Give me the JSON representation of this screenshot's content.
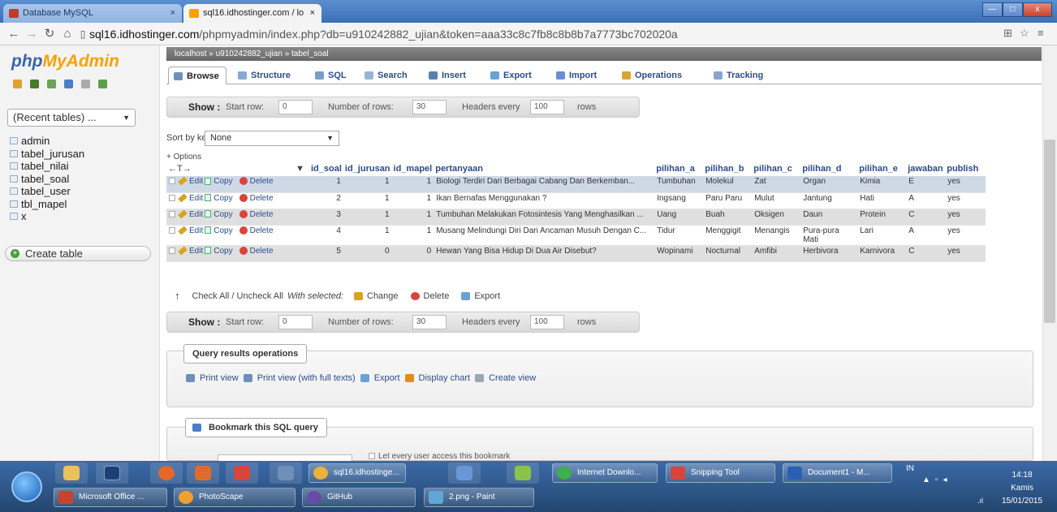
{
  "browser": {
    "tabs": [
      {
        "title": "Database MySQL",
        "close": "×"
      },
      {
        "title": "sql16.idhostinger.com / lo",
        "close": "×"
      }
    ],
    "url_host": "sql16.idhostinger.com",
    "url_path": "/phpmyadmin/index.php?db=u910242882_ujian&token=aaa33c8c7fb8c8b8b7a7773bc702020a",
    "win_controls": [
      "—",
      "□",
      "x"
    ]
  },
  "sidebar": {
    "logo_php": "php",
    "logo_myadmin": "MyAdmin",
    "recent_tables": "(Recent tables) ...",
    "tables": [
      "admin",
      "tabel_jurusan",
      "tabel_nilai",
      "tabel_soal",
      "tabel_user",
      "tbl_mapel",
      "x"
    ],
    "create_table": "Create table"
  },
  "breadcrumb": {
    "server": "localhost",
    "database": "u910242882_ujian",
    "table": "tabel_soal",
    "sep": "»"
  },
  "tabs": [
    "Browse",
    "Structure",
    "SQL",
    "Search",
    "Insert",
    "Export",
    "Import",
    "Operations",
    "Tracking"
  ],
  "showbar": {
    "show": "Show :",
    "start_row_label": "Start row:",
    "start_row": "0",
    "num_rows_label": "Number of rows:",
    "num_rows": "30",
    "headers_label": "Headers every",
    "headers": "100",
    "rows": "rows"
  },
  "sort": {
    "label": "Sort by key:",
    "value": "None"
  },
  "options": "+ Options",
  "arrows": "←T→",
  "table": {
    "columns": [
      "id_soal",
      "id_jurusan",
      "id_mapel",
      "pertanyaan",
      "pilihan_a",
      "pilihan_b",
      "pilihan_c",
      "pilihan_d",
      "pilihan_e",
      "jawaban",
      "publish"
    ],
    "actions": {
      "edit": "Edit",
      "copy": "Copy",
      "delete": "Delete"
    },
    "rows": [
      {
        "id_soal": "1",
        "id_jurusan": "1",
        "id_mapel": "1",
        "pertanyaan": "Biologi Terdiri Dari Berbagai Cabang Dan Berkemban...",
        "pilihan_a": "Tumbuhan",
        "pilihan_b": "Molekul",
        "pilihan_c": "Zat",
        "pilihan_d": "Organ",
        "pilihan_e": "Kimia",
        "jawaban": "E",
        "publish": "yes"
      },
      {
        "id_soal": "2",
        "id_jurusan": "1",
        "id_mapel": "1",
        "pertanyaan": "Ikan Bernafas Menggunakan ?",
        "pilihan_a": "Ingsang",
        "pilihan_b": "Paru Paru",
        "pilihan_c": "Mulut",
        "pilihan_d": "Jantung",
        "pilihan_e": "Hati",
        "jawaban": "A",
        "publish": "yes"
      },
      {
        "id_soal": "3",
        "id_jurusan": "1",
        "id_mapel": "1",
        "pertanyaan": "Tumbuhan Melakukan Fotosintesis Yang Menghasilkan ...",
        "pilihan_a": "Uang",
        "pilihan_b": "Buah",
        "pilihan_c": "Oksigen",
        "pilihan_d": "Daun",
        "pilihan_e": "Protein",
        "jawaban": "C",
        "publish": "yes"
      },
      {
        "id_soal": "4",
        "id_jurusan": "1",
        "id_mapel": "1",
        "pertanyaan": "Musang Melindungi Diri Dari Ancaman Musuh Dengan C...",
        "pilihan_a": "Tidur",
        "pilihan_b": "Menggigit",
        "pilihan_c": "Menangis",
        "pilihan_d": "Pura-pura Mati",
        "pilihan_e": "Lari",
        "jawaban": "A",
        "publish": "yes"
      },
      {
        "id_soal": "5",
        "id_jurusan": "0",
        "id_mapel": "0",
        "pertanyaan": "Hewan Yang Bisa Hidup Di Dua Air Disebut?",
        "pilihan_a": "Wopinami",
        "pilihan_b": "Nocturnal",
        "pilihan_c": "Amfibi",
        "pilihan_d": "Herbivora",
        "pilihan_e": "Karnivora",
        "jawaban": "C",
        "publish": "yes"
      }
    ]
  },
  "withsel": {
    "check_all": "Check All / Uncheck All",
    "with_selected": "With selected:",
    "change": "Change",
    "delete": "Delete",
    "export": "Export"
  },
  "qro": {
    "legend": "Query results operations",
    "links": [
      "Print view",
      "Print view (with full texts)",
      "Export",
      "Display chart",
      "Create view"
    ]
  },
  "bookmark": {
    "legend": "Bookmark this SQL query",
    "let_every": "Let every user access this bookmark"
  },
  "taskbar": {
    "row1": [
      "sql16.idhostinge...",
      "Internet Downlo...",
      "Snipping Tool",
      "Document1 - M..."
    ],
    "row2": [
      "Microsoft Office ...",
      "PhotoScape",
      "GitHub",
      "2.png - Paint"
    ],
    "lang": "IN",
    "time": "14:18",
    "day": "Kamis",
    "date": "15/01/2015"
  }
}
